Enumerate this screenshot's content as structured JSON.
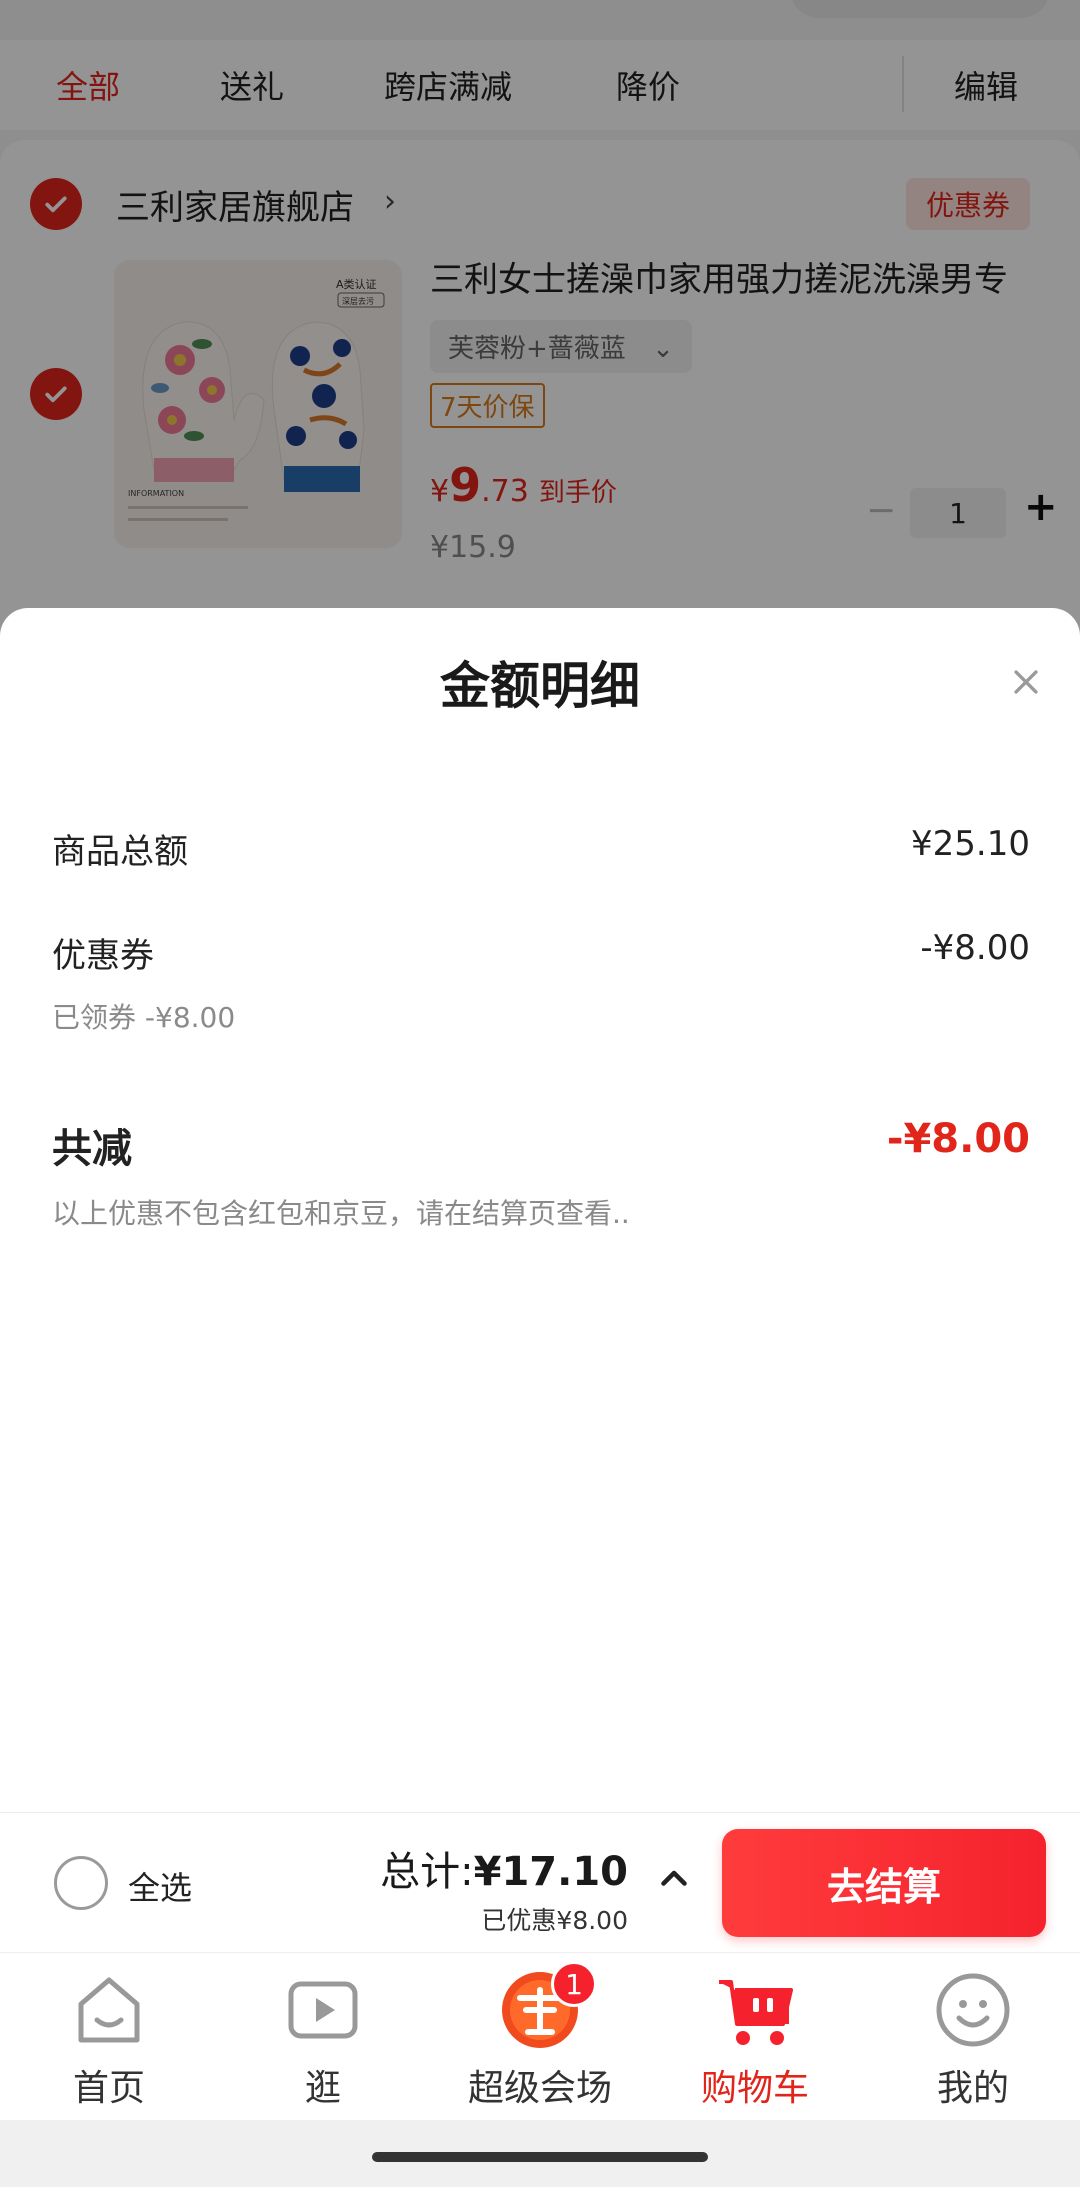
{
  "filter_tabs": {
    "all": "全部",
    "gift": "送礼",
    "cross_store": "跨店满减",
    "price_drop": "降价",
    "edit": "编辑"
  },
  "store": {
    "name": "三利家居旗舰店",
    "arrow": "›",
    "coupon_tag": "优惠券"
  },
  "product": {
    "title": "三利女士搓澡巾家用强力搓泥洗澡男专",
    "sku": "芙蓉粉+蔷薇蓝",
    "sku_arrow": "⌄",
    "price_protect": "7天价保",
    "price_currency": "¥",
    "price_integer": "9",
    "price_decimal": ".73",
    "price_label": "到手价",
    "original_price": "¥15.9",
    "quantity": "1",
    "minus": "−",
    "plus": "+",
    "img_badge": "A类认证",
    "img_badge_sub": "深层去污",
    "img_caption": "INFORMATION"
  },
  "sheet": {
    "title": "金额明细",
    "items_total_label": "商品总额",
    "items_total_value": "¥25.10",
    "coupon_label": "优惠券",
    "coupon_value": "-¥8.00",
    "coupon_sub": "已领券 -¥8.00",
    "total_discount_label": "共减",
    "total_discount_value": "-¥8.00",
    "note": "以上优惠不包含红包和京豆，请在结算页查看.."
  },
  "checkout": {
    "select_all": "全选",
    "total_prefix": "总计:",
    "total_amount": "¥17.10",
    "saved": "已优惠¥8.00",
    "button": "去结算"
  },
  "tabbar": {
    "home": "首页",
    "browse": "逛",
    "super_venue": "超级会场",
    "super_venue_badge": "1",
    "cart": "购物车",
    "mine": "我的"
  },
  "colors": {
    "accent": "#e1251b",
    "checkout_button": "#f5222d",
    "price_protect": "#d97a1c"
  }
}
